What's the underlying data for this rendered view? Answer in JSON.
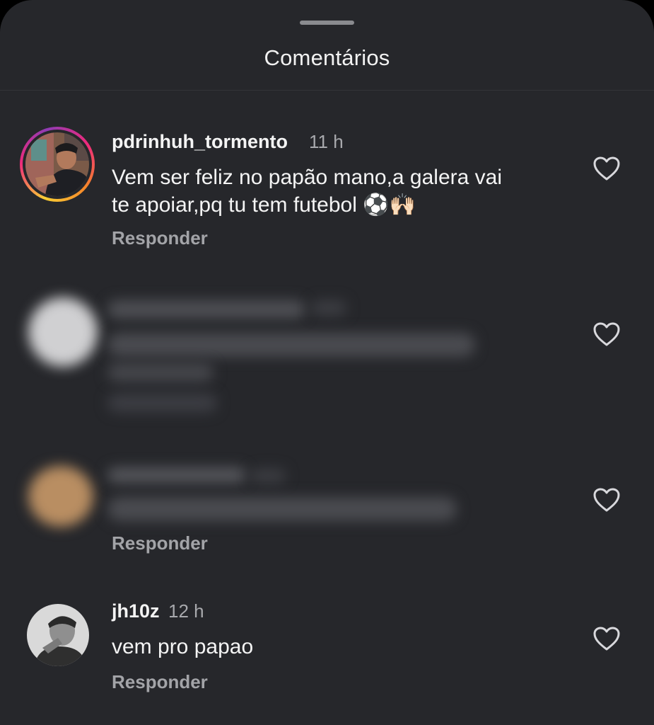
{
  "sheet": {
    "title": "Comentários"
  },
  "comments": [
    {
      "username": "pdrinhuh_tormento",
      "time": "11 h",
      "text_line1": "Vem ser feliz no papão mano,a galera vai",
      "text_line2": "te apoiar,pq tu tem futebol ⚽🙌🏻",
      "reply_label": "Responder",
      "like_icon": "heart-outline-icon",
      "avatar_story_ring": true
    },
    {
      "blurred": true,
      "like_icon": "heart-outline-icon"
    },
    {
      "blurred": true,
      "reply_label": "Responder",
      "like_icon": "heart-outline-icon"
    },
    {
      "username": "jh10z",
      "time": "12 h",
      "text_line1": "vem pro papao",
      "reply_label": "Responder",
      "like_icon": "heart-outline-icon"
    }
  ],
  "colors": {
    "sheet_bg": "#26272b",
    "primary_text": "#f4f4f4",
    "secondary_text": "#a8a9ad",
    "story_ring": [
      "#f9ce34",
      "#ee2a7b",
      "#8f3bb5"
    ]
  }
}
